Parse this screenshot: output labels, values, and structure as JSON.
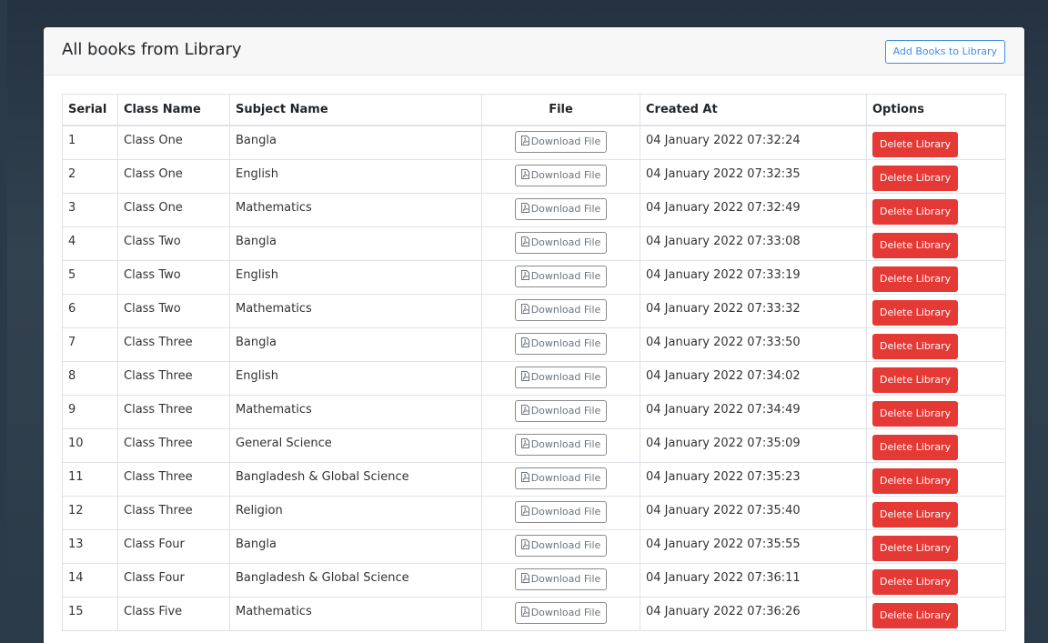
{
  "page": {
    "title": "All books from Library",
    "add_button": "Add Books to Library"
  },
  "table": {
    "headers": {
      "serial": "Serial",
      "class_name": "Class Name",
      "subject_name": "Subject Name",
      "file": "File",
      "created_at": "Created At",
      "options": "Options"
    },
    "download_label": "Download File",
    "delete_label": "Delete Library",
    "rows": [
      {
        "serial": "1",
        "class_name": "Class One",
        "subject": "Bangla",
        "created_at": "04 January 2022 07:32:24"
      },
      {
        "serial": "2",
        "class_name": "Class One",
        "subject": "English",
        "created_at": "04 January 2022 07:32:35"
      },
      {
        "serial": "3",
        "class_name": "Class One",
        "subject": "Mathematics",
        "created_at": "04 January 2022 07:32:49"
      },
      {
        "serial": "4",
        "class_name": "Class Two",
        "subject": "Bangla",
        "created_at": "04 January 2022 07:33:08"
      },
      {
        "serial": "5",
        "class_name": "Class Two",
        "subject": "English",
        "created_at": "04 January 2022 07:33:19"
      },
      {
        "serial": "6",
        "class_name": "Class Two",
        "subject": "Mathematics",
        "created_at": "04 January 2022 07:33:32"
      },
      {
        "serial": "7",
        "class_name": "Class Three",
        "subject": "Bangla",
        "created_at": "04 January 2022 07:33:50"
      },
      {
        "serial": "8",
        "class_name": "Class Three",
        "subject": "English",
        "created_at": "04 January 2022 07:34:02"
      },
      {
        "serial": "9",
        "class_name": "Class Three",
        "subject": "Mathematics",
        "created_at": "04 January 2022 07:34:49"
      },
      {
        "serial": "10",
        "class_name": "Class Three",
        "subject": "General Science",
        "created_at": "04 January 2022 07:35:09"
      },
      {
        "serial": "11",
        "class_name": "Class Three",
        "subject": "Bangladesh & Global Science",
        "created_at": "04 January 2022 07:35:23"
      },
      {
        "serial": "12",
        "class_name": "Class Three",
        "subject": "Religion",
        "created_at": "04 January 2022 07:35:40"
      },
      {
        "serial": "13",
        "class_name": "Class Four",
        "subject": "Bangla",
        "created_at": "04 January 2022 07:35:55"
      },
      {
        "serial": "14",
        "class_name": "Class Four",
        "subject": "Bangladesh & Global Science",
        "created_at": "04 January 2022 07:36:11"
      },
      {
        "serial": "15",
        "class_name": "Class Five",
        "subject": "Mathematics",
        "created_at": "04 January 2022 07:36:26"
      }
    ]
  },
  "icons": {
    "download": "file-pdf-icon"
  },
  "colors": {
    "accent": "#3b8ee8",
    "danger": "#e53935",
    "background": "#2f3e4d"
  }
}
